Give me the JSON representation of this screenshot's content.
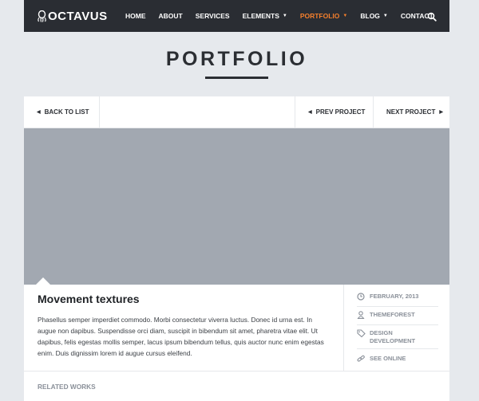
{
  "brand": {
    "name": "OCTAVUS"
  },
  "nav": {
    "items": [
      {
        "label": "HOME",
        "active": false,
        "dropdown": false
      },
      {
        "label": "ABOUT",
        "active": false,
        "dropdown": false
      },
      {
        "label": "SERVICES",
        "active": false,
        "dropdown": false
      },
      {
        "label": "ELEMENTS",
        "active": false,
        "dropdown": true
      },
      {
        "label": "PORTFOLIO",
        "active": true,
        "dropdown": true
      },
      {
        "label": "BLOG",
        "active": false,
        "dropdown": true
      },
      {
        "label": "CONTACT",
        "active": false,
        "dropdown": false
      }
    ],
    "search_icon": "search-icon"
  },
  "page": {
    "title": "PORTFOLIO"
  },
  "pager": {
    "back_label": "BACK TO LIST",
    "prev_label": "PREV PROJECT",
    "next_label": "NEXT PROJECT"
  },
  "project": {
    "title": "Movement textures",
    "description": "Phasellus semper imperdiet commodo. Morbi consectetur viverra luctus. Donec id urna est. In augue non dapibus. Suspendisse orci diam, suscipit in bibendum sit amet, pharetra vitae elit. Ut dapibus, felis egestas mollis semper, lacus ipsum bibendum tellus, quis auctor nunc enim egestas enim. Duis dignissim lorem id augue cursus eleifend.",
    "meta": {
      "date": "FEBRUARY, 2013",
      "client": "THEMEFOREST",
      "category": "DESIGN DEVELOPMENT",
      "link": "SEE ONLINE"
    }
  },
  "related": {
    "label": "RELATED WORKS"
  },
  "colors": {
    "nav_bg": "#2a2d33",
    "accent": "#f47f2c",
    "hero_placeholder": "#a2a8b1",
    "page_bg": "#e6e9ed"
  }
}
